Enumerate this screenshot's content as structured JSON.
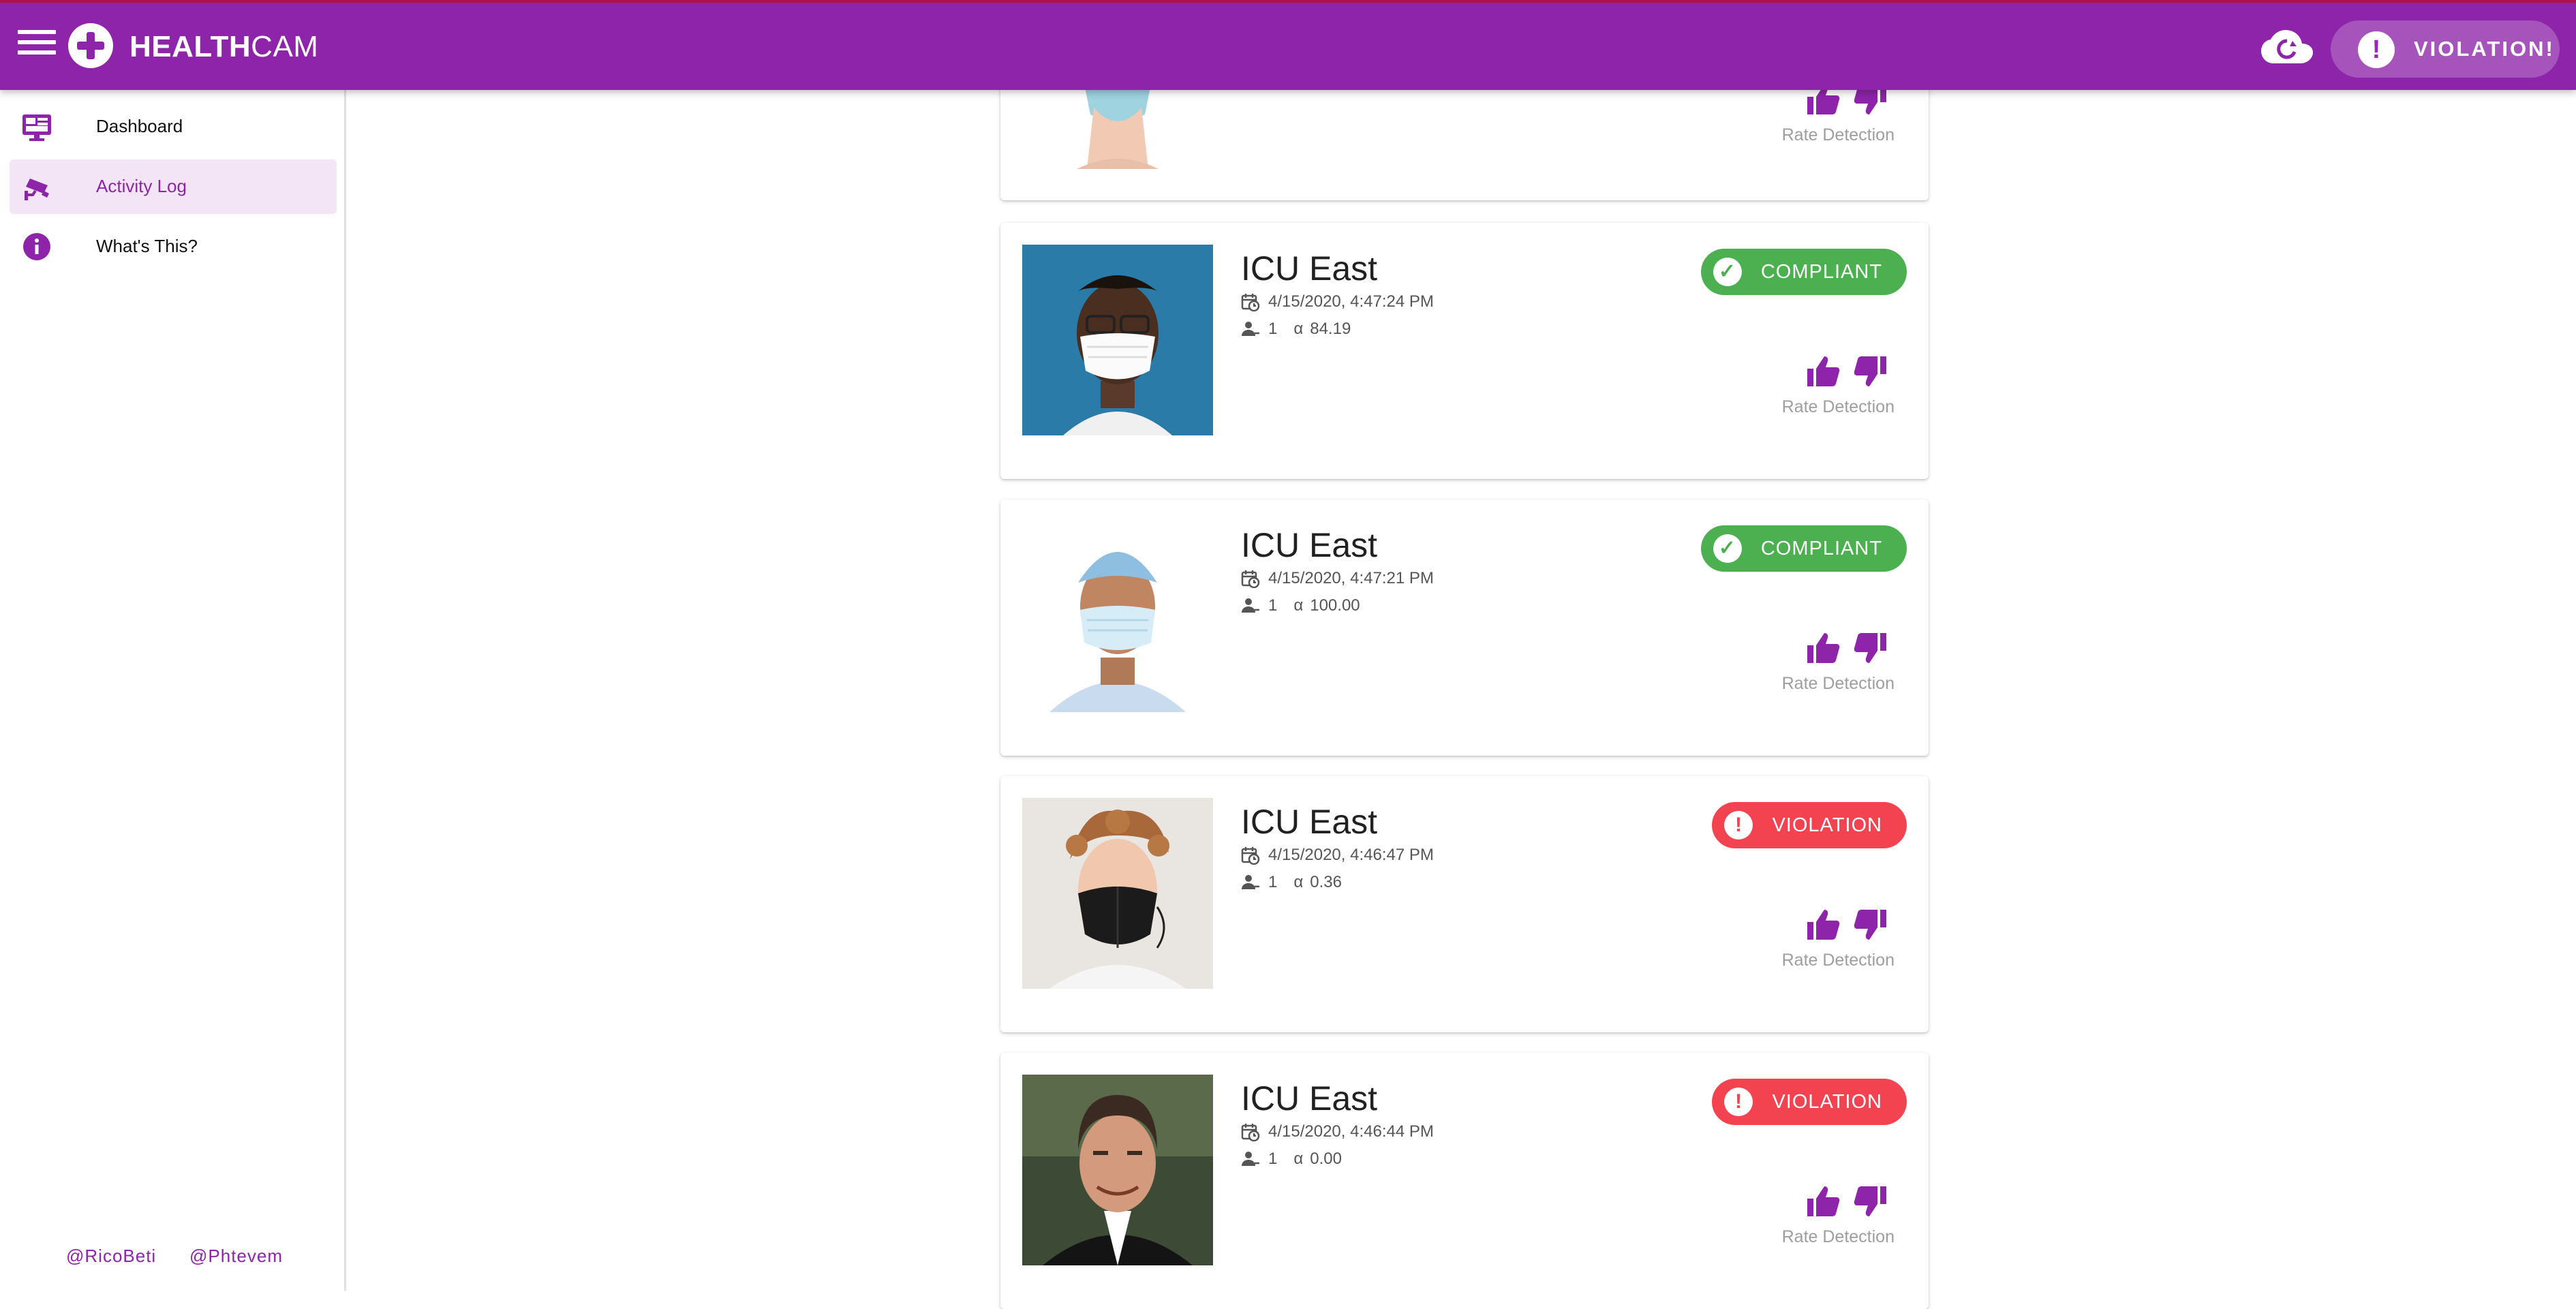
{
  "app": {
    "brand_bold": "HEALTH",
    "brand_light": "CAM",
    "alert_label": "VIOLATION!"
  },
  "sidebar": {
    "items": [
      {
        "label": "Dashboard",
        "icon": "monitor-dashboard-icon"
      },
      {
        "label": "Activity Log",
        "icon": "cctv-camera-icon",
        "active": true
      },
      {
        "label": "What's This?",
        "icon": "info-icon"
      }
    ],
    "footer_links": [
      "@RicoBeti",
      "@Phtevem"
    ]
  },
  "colors": {
    "primary": "#8e24aa",
    "compliant": "#4caf50",
    "violation": "#f44350",
    "active_nav_bg": "#f3e5f5"
  },
  "log": {
    "rate_label": "Rate Detection",
    "entries": [
      {
        "location": "",
        "timestamp": "",
        "people": "",
        "alpha": "",
        "status": "",
        "partial": true
      },
      {
        "location": "ICU East",
        "timestamp": "4/15/2020, 4:47:24 PM",
        "people": "1",
        "alpha": "84.19",
        "status": "COMPLIANT"
      },
      {
        "location": "ICU East",
        "timestamp": "4/15/2020, 4:47:21 PM",
        "people": "1",
        "alpha": "100.00",
        "status": "COMPLIANT"
      },
      {
        "location": "ICU East",
        "timestamp": "4/15/2020, 4:46:47 PM",
        "people": "1",
        "alpha": "0.36",
        "status": "VIOLATION"
      },
      {
        "location": "ICU East",
        "timestamp": "4/15/2020, 4:46:44 PM",
        "people": "1",
        "alpha": "0.00",
        "status": "VIOLATION"
      }
    ]
  }
}
